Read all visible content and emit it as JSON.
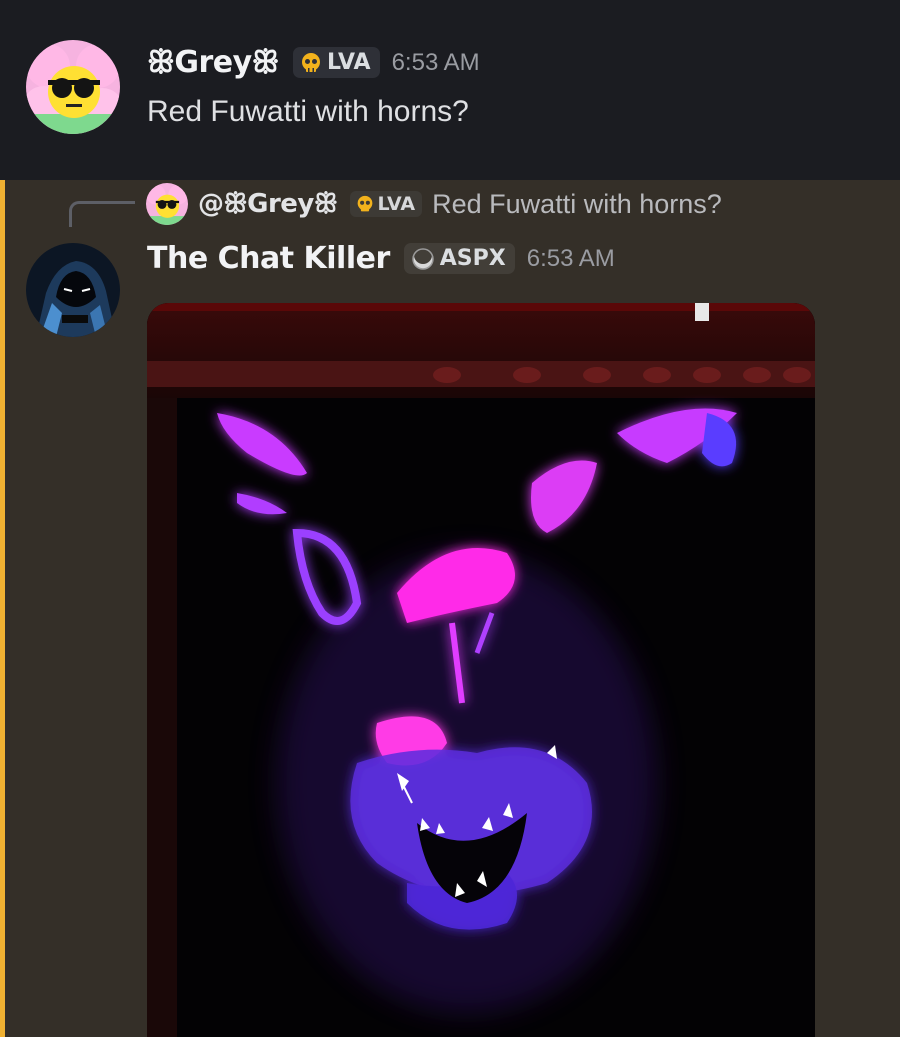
{
  "messages": [
    {
      "author": "ꕥGreyꕥ",
      "tag": {
        "icon": "skull-icon",
        "label": "LVA"
      },
      "timestamp": "6:53 AM",
      "content": "Red Fuwatti with horns?",
      "avatar": "flower-sunglasses-avatar"
    },
    {
      "author": "The Chat Killer",
      "tag": {
        "icon": "crescent-moon-icon",
        "label": "ASPX"
      },
      "timestamp": "6:53 AM",
      "avatar": "hooded-figure-avatar",
      "reply_to": {
        "mention": "@ꕥGreyꕥ",
        "tag": {
          "icon": "skull-icon",
          "label": "LVA"
        },
        "content": "Red Fuwatti with horns?"
      },
      "attachment": {
        "type": "image",
        "icon": "neon-creature-image"
      }
    }
  ],
  "colors": {
    "background": "#1b1c21",
    "mention_highlight": "#342f28",
    "mention_bar": "#f0b132",
    "neon_magenta": "#ff2ce8",
    "neon_violet": "#6a2bff"
  }
}
